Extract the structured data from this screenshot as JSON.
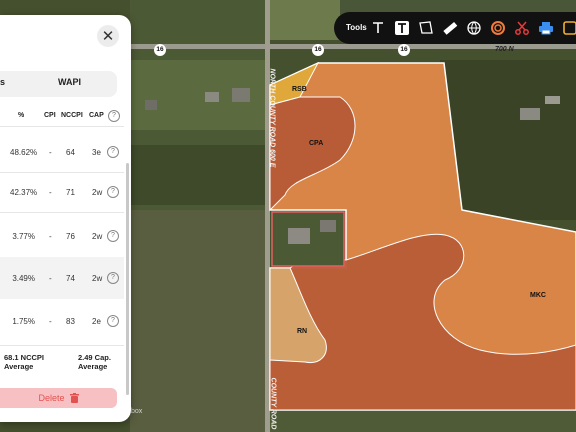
{
  "toolbar": {
    "label": "Tools",
    "tools": [
      "text-icon",
      "text-box-icon",
      "polygon-icon",
      "ruler-icon",
      "globe-icon",
      "circle-icon",
      "scissors-icon",
      "print-icon",
      "square-icon"
    ]
  },
  "map": {
    "roads": {
      "east_west": "700 N",
      "north_south": "NORTH COUNTY ROAD 600 E",
      "route_shield": "16",
      "lower_road": "COUNTY ROAD"
    },
    "soil_labels": [
      "RSB",
      "CPA",
      "MKC",
      "RN"
    ],
    "colors": {
      "field_light": "#e58a4a",
      "field_dark": "#b85c38",
      "rsb": "#e0a83a",
      "rn": "#d6a46a",
      "boundary": "#ffffff"
    },
    "attribution": "box"
  },
  "panel": {
    "tabs": [
      "s",
      "WAPI"
    ],
    "headers": {
      "pct": "%",
      "cpi": "CPI",
      "nccpi": "NCCPI",
      "cap": "CAP"
    },
    "rows": [
      {
        "pct": "48.62%",
        "cpi": "-",
        "nccpi": "64",
        "cap": "3e"
      },
      {
        "pct": "42.37%",
        "cpi": "-",
        "nccpi": "71",
        "cap": "2w"
      },
      {
        "pct": "3.77%",
        "cpi": "-",
        "nccpi": "76",
        "cap": "2w"
      },
      {
        "pct": "3.49%",
        "cpi": "-",
        "nccpi": "74",
        "cap": "2w"
      },
      {
        "pct": "1.75%",
        "cpi": "-",
        "nccpi": "83",
        "cap": "2e"
      }
    ],
    "summary": {
      "nccpi_value": "68.1 NCCPI",
      "nccpi_sub": "Average",
      "cap_value": "2.49 Cap.",
      "cap_sub": "Average"
    },
    "delete_label": "Delete",
    "help_glyph": "?",
    "close_glyph": "✕"
  }
}
